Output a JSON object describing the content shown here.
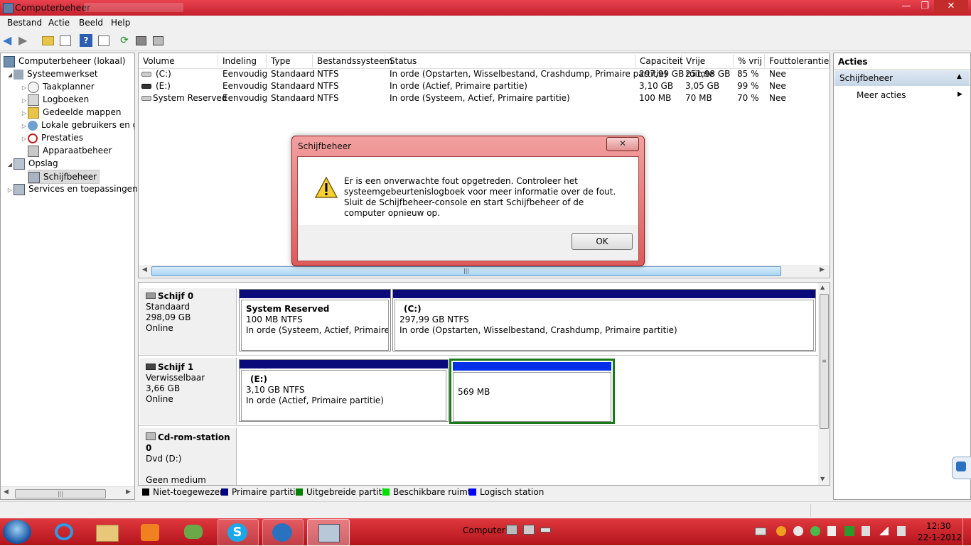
{
  "window": {
    "title": "Computerbeheer",
    "title_suffix": ""
  },
  "menu": [
    "Bestand",
    "Actie",
    "Beeld",
    "Help"
  ],
  "tree": {
    "root": "Computerbeheer (lokaal)",
    "systeemwerkset": "Systeemwerkset",
    "taakplanner": "Taakplanner",
    "logboeken": "Logboeken",
    "gedeelde": "Gedeelde mappen",
    "lokale": "Lokale gebruikers en groepen",
    "prestaties": "Prestaties",
    "apparaatbeheer": "Apparaatbeheer",
    "opslag": "Opslag",
    "schijfbeheer": "Schijfbeheer",
    "services": "Services en toepassingen"
  },
  "list": {
    "headers": [
      "Volume",
      "Indeling",
      "Type",
      "Bestandssysteem",
      "Status",
      "Capaciteit",
      "Vrije ruimte",
      "% vrij",
      "Fouttolerantie"
    ],
    "rows": [
      [
        "(C:)",
        "Eenvoudig",
        "Standaard",
        "NTFS",
        "In orde (Opstarten, Wisselbestand, Crashdump, Primaire partitie)",
        "297,99 GB",
        "251,98 GB",
        "85 %",
        "Nee"
      ],
      [
        "(E:)",
        "Eenvoudig",
        "Standaard",
        "NTFS",
        "In orde (Actief, Primaire partitie)",
        "3,10 GB",
        "3,05 GB",
        "99 %",
        "Nee"
      ],
      [
        "System Reserved",
        "Eenvoudig",
        "Standaard",
        "NTFS",
        "In orde (Systeem, Actief, Primaire partitie)",
        "100 MB",
        "70 MB",
        "70 %",
        "Nee"
      ]
    ]
  },
  "disks": {
    "d0": {
      "name": "Schijf 0",
      "type": "Standaard",
      "size": "298,09 GB",
      "state": "Online"
    },
    "d0p1": {
      "name": "System Reserved",
      "size": "100 MB NTFS",
      "status": "In orde (Systeem, Actief, Primaire partitie)"
    },
    "d0p2": {
      "name": "(C:)",
      "size": "297,99 GB NTFS",
      "status": "In orde (Opstarten, Wisselbestand, Crashdump, Primaire partitie)"
    },
    "d1": {
      "name": "Schijf 1",
      "type": "Verwisselbaar",
      "size": "3,66 GB",
      "state": "Online"
    },
    "d1p1": {
      "name": "(E:)",
      "size": "3,10 GB NTFS",
      "status": "In orde (Actief, Primaire partitie)"
    },
    "d1p2": {
      "size": "569 MB"
    },
    "cd": {
      "name": "Cd-rom-station 0",
      "type": "Dvd (D:)",
      "media": "Geen medium"
    }
  },
  "legend": [
    {
      "label": "Niet-toegewezen",
      "color": "#000000"
    },
    {
      "label": "Primaire partitie",
      "color": "#000080"
    },
    {
      "label": "Uitgebreide partitie",
      "color": "#008000"
    },
    {
      "label": "Beschikbare ruimte",
      "color": "#00e000"
    },
    {
      "label": "Logisch station",
      "color": "#0000ff"
    }
  ],
  "actions": {
    "header": "Acties",
    "section": "Schijfbeheer",
    "more": "Meer acties"
  },
  "dialog": {
    "title": "Schijfbeheer",
    "message": "Er is een onverwachte fout opgetreden. Controleer het systeemgebeurtenislogboek voor meer informatie over de fout. Sluit de Schijfbeheer-console en start Schijfbeheer of de computer opnieuw op.",
    "ok": "OK"
  },
  "taskbar": {
    "computer": "Computer",
    "time": "12:30",
    "date": "22-1-2012"
  },
  "colors": {
    "titlebar": "#d4303c",
    "taskbar": "#c8202a",
    "selection": "#cfe0f4",
    "primary": "#0a0a7a"
  }
}
